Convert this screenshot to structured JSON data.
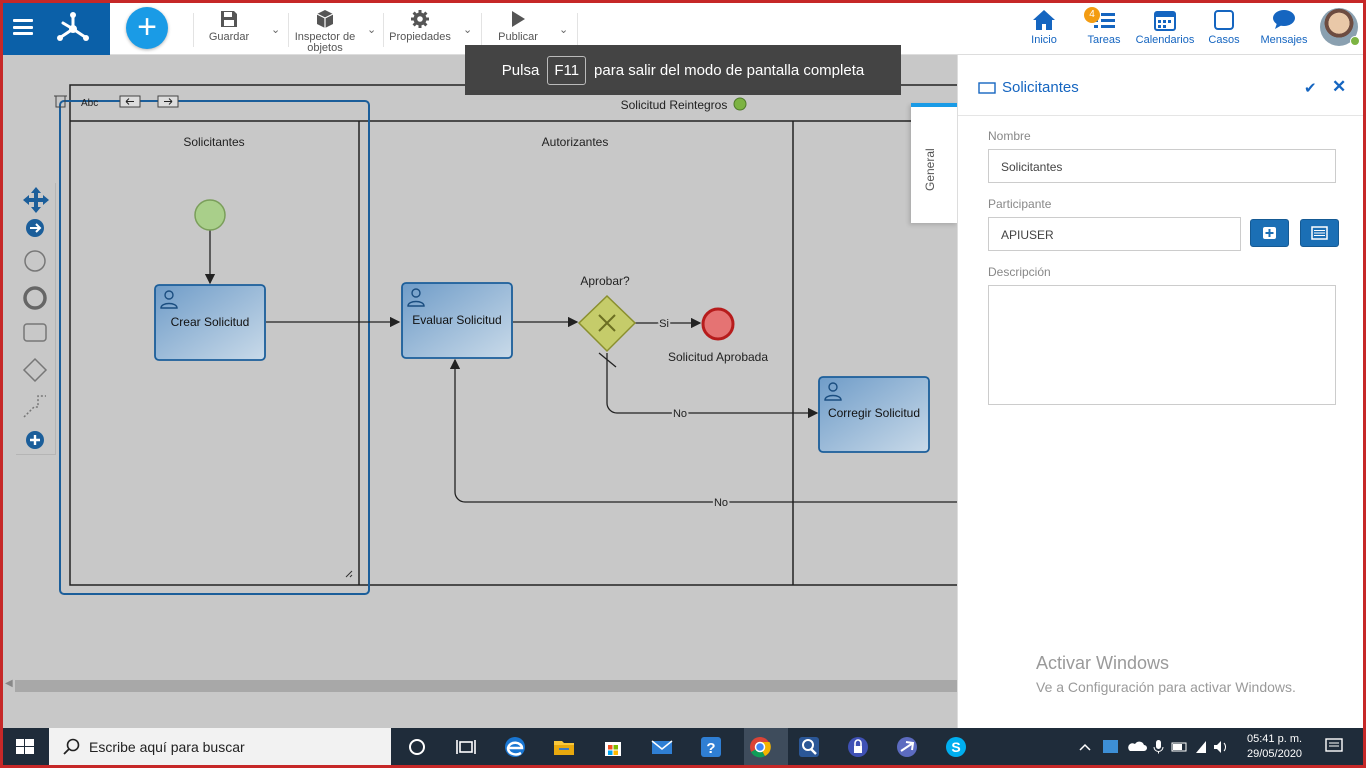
{
  "toolbar": {
    "guardar": "Guardar",
    "inspector_line1": "Inspector de",
    "inspector_line2": "objetos",
    "propiedades": "Propiedades",
    "publicar": "Publicar"
  },
  "nav": {
    "inicio": "Inicio",
    "tareas": "Tareas",
    "tareas_badge": "4",
    "calendarios": "Calendarios",
    "casos": "Casos",
    "mensajes": "Mensajes"
  },
  "fullscreen": {
    "before": "Pulsa",
    "key": "F11",
    "after": "para salir del modo de pantalla completa"
  },
  "diagram": {
    "pool_name": "Solicitud Reintegros",
    "lanes": [
      "Solicitantes",
      "Autorizantes"
    ],
    "lane_label_edit": "Abc",
    "tasks": [
      "Crear Solicitud",
      "Evaluar Solicitud",
      "Corregir Solicitud"
    ],
    "gateway_label": "Aprobar?",
    "flow_yes": "Si",
    "flow_no_1": "No",
    "flow_no_2": "No",
    "end_label": "Solicitud Aprobada"
  },
  "panel": {
    "title": "Solicitantes",
    "side_tab": "General",
    "nombre_label": "Nombre",
    "nombre_value": "Solicitantes",
    "participante_label": "Participante",
    "participante_value": "APIUSER",
    "descripcion_label": "Descripción",
    "descripcion_value": ""
  },
  "watermark": {
    "title": "Activar Windows",
    "subtitle": "Ve a Configuración para activar Windows."
  },
  "taskbar": {
    "search_placeholder": "Escribe aquí para buscar",
    "time": "05:41 p. m.",
    "date": "29/05/2020"
  },
  "colors": {
    "brand": "#0b60a8",
    "accent": "#1a9be6",
    "task_fill": "#8fb3d6",
    "start_event": "#a9cf8a",
    "end_event": "#e57373",
    "gateway": "#c5cc6a"
  }
}
